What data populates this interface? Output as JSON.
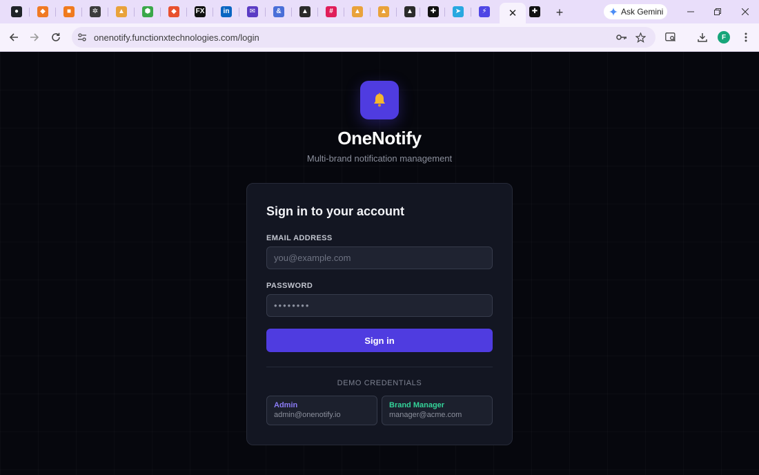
{
  "browser": {
    "tabs": [
      {
        "icon": "github-icon",
        "color": "#1f2328",
        "glyph": "●"
      },
      {
        "icon": "orange-app-icon",
        "color": "#f07a24",
        "glyph": "◆"
      },
      {
        "icon": "cube-icon",
        "color": "#f07a1e",
        "glyph": "■"
      },
      {
        "icon": "openai-icon",
        "color": "#3c3c3c",
        "glyph": "✲"
      },
      {
        "icon": "stacked-app-icon",
        "color": "#e9a23b",
        "glyph": "▲"
      },
      {
        "icon": "hexagon-icon",
        "color": "#3aa84a",
        "glyph": "⬢"
      },
      {
        "icon": "git-icon",
        "color": "#e8502e",
        "glyph": "◆"
      },
      {
        "icon": "fx-icon",
        "color": "#111111",
        "glyph": "FX"
      },
      {
        "icon": "linkedin-icon",
        "color": "#0a66c2",
        "glyph": "in"
      },
      {
        "icon": "mail-stack-icon",
        "color": "#5b3cc4",
        "glyph": "✉"
      },
      {
        "icon": "ampersand-icon",
        "color": "#4a6fd8",
        "glyph": "&"
      },
      {
        "icon": "graduation-cap-icon",
        "color": "#2b2b2b",
        "glyph": "▲"
      },
      {
        "icon": "slack-icon",
        "color": "#e01e5a",
        "glyph": "#"
      },
      {
        "icon": "stacked-app-icon",
        "color": "#e9a23b",
        "glyph": "▲"
      },
      {
        "icon": "stacked-app-icon",
        "color": "#e9a23b",
        "glyph": "▲"
      },
      {
        "icon": "graduation-cap-icon",
        "color": "#2b2b2b",
        "glyph": "▲"
      },
      {
        "icon": "plus-square-icon",
        "color": "#111111",
        "glyph": "✚"
      },
      {
        "icon": "paper-plane-icon",
        "color": "#29a8e0",
        "glyph": "➤"
      },
      {
        "icon": "bolt-icon",
        "color": "#4f46e5",
        "glyph": "⚡"
      }
    ],
    "active_tab_close": "✕",
    "last_tab": {
      "icon": "plus-square-icon",
      "color": "#111111",
      "glyph": "✚"
    },
    "new_tab": "+",
    "gemini_label": "Ask Gemini",
    "url": "onenotify.functionxtechnologies.com/login",
    "profile_initial": "F"
  },
  "app": {
    "name": "OneNotify",
    "tagline": "Multi-brand notification management"
  },
  "login": {
    "title": "Sign in to your account",
    "email_label": "EMAIL ADDRESS",
    "email_placeholder": "you@example.com",
    "password_label": "PASSWORD",
    "password_placeholder": "••••••••",
    "submit_label": "Sign in",
    "demo_heading": "DEMO CREDENTIALS",
    "demo_accounts": [
      {
        "role": "Admin",
        "email": "admin@onenotify.io",
        "color": "#8b7cf6"
      },
      {
        "role": "Brand Manager",
        "email": "manager@acme.com",
        "color": "#34d399"
      }
    ]
  },
  "colors": {
    "accent": "#4f3ce0",
    "page_background": "#06070d",
    "card_background": "#131622",
    "bell": "#f5b82e"
  }
}
